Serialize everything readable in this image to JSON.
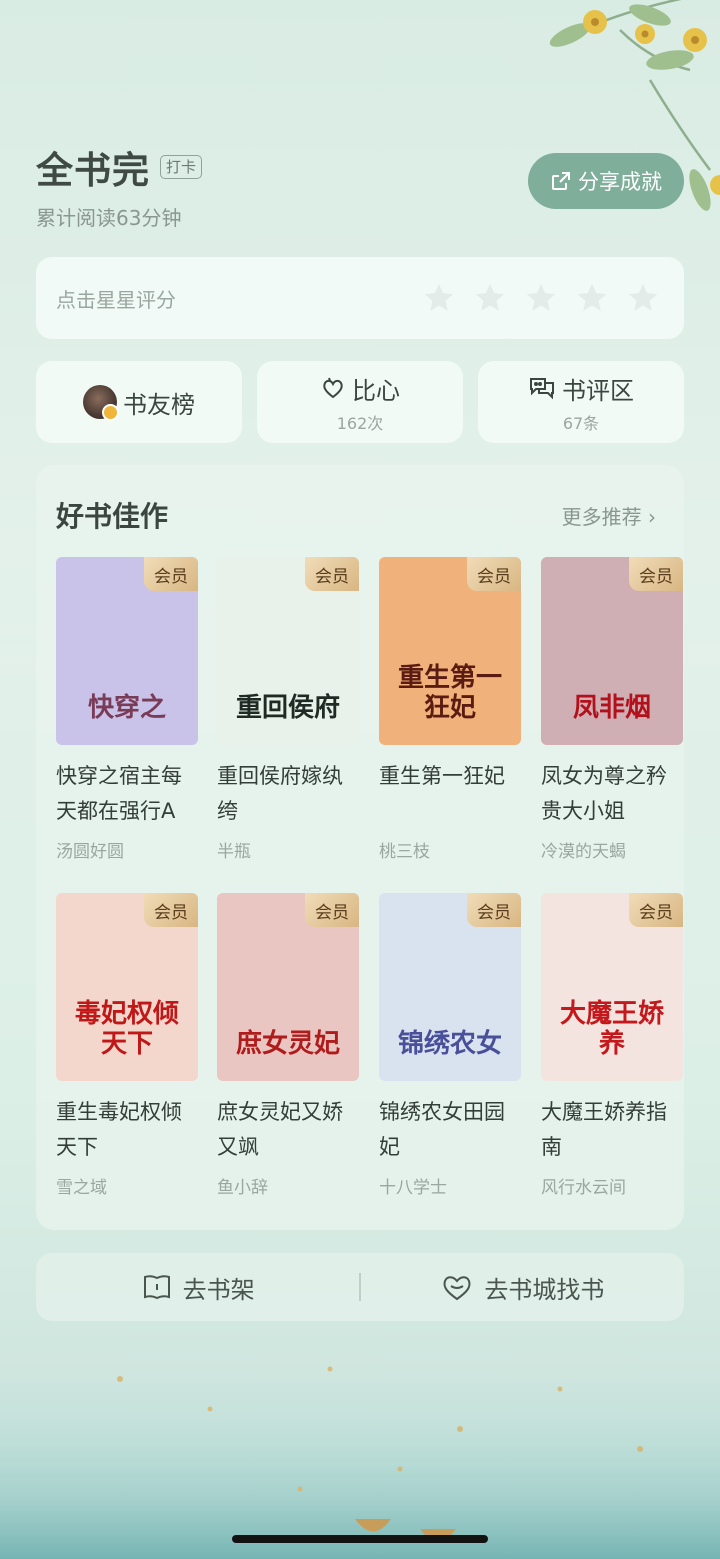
{
  "header": {
    "title": "全书完",
    "checkin_label": "打卡",
    "reading_time": "累计阅读63分钟",
    "share_label": "分享成就"
  },
  "rating": {
    "prompt": "点击星星评分",
    "star_count": 5
  },
  "actions": [
    {
      "label": "书友榜",
      "sub": ""
    },
    {
      "label": "比心",
      "sub": "162次"
    },
    {
      "label": "书评区",
      "sub": "67条"
    }
  ],
  "recommendations": {
    "title": "好书佳作",
    "more_label": "更多推荐",
    "books": [
      {
        "name": "快穿之宿主每天都在强行A",
        "author": "汤圆好圆",
        "badge": "会员",
        "cover_text": "快穿之",
        "cover_bg": "#c9c3ea",
        "cover_color": "#7a3b57"
      },
      {
        "name": "重回侯府嫁纨绔",
        "author": "半瓶",
        "badge": "会员",
        "cover_text": "重回侯府",
        "cover_bg": "#e9f2ea",
        "cover_color": "#1f2a24"
      },
      {
        "name": "重生第一狂妃",
        "author": "桃三枝",
        "badge": "会员",
        "cover_text": "重生第一狂妃",
        "cover_bg": "#f1b17a",
        "cover_color": "#5a1c12"
      },
      {
        "name": "凤女为尊之矜贵大小姐",
        "author": "冷漠的天蝎",
        "badge": "会员",
        "cover_text": "凤非烟",
        "cover_bg": "#cfaeb4",
        "cover_color": "#b2101a"
      },
      {
        "name": "重生毒妃权倾天下",
        "author": "雪之域",
        "badge": "会员",
        "cover_text": "毒妃权倾天下",
        "cover_bg": "#f3d6cc",
        "cover_color": "#c01818"
      },
      {
        "name": "庶女灵妃又娇又飒",
        "author": "鱼小辞",
        "badge": "会员",
        "cover_text": "庶女灵妃",
        "cover_bg": "#e9c6c2",
        "cover_color": "#b01c1c"
      },
      {
        "name": "锦绣农女田园妃",
        "author": "十八学士",
        "badge": "会员",
        "cover_text": "锦绣农女",
        "cover_bg": "#d9e3ef",
        "cover_color": "#4a4f9a"
      },
      {
        "name": "大魔王娇养指南",
        "author": "风行水云间",
        "badge": "会员",
        "cover_text": "大魔王娇养",
        "cover_bg": "#f4e4df",
        "cover_color": "#c4181c"
      }
    ]
  },
  "bottom_bar": {
    "bookshelf_label": "去书架",
    "store_label": "去书城找书"
  },
  "colors": {
    "accent": "#7fae9b",
    "badge_gold": "#d8b682"
  }
}
